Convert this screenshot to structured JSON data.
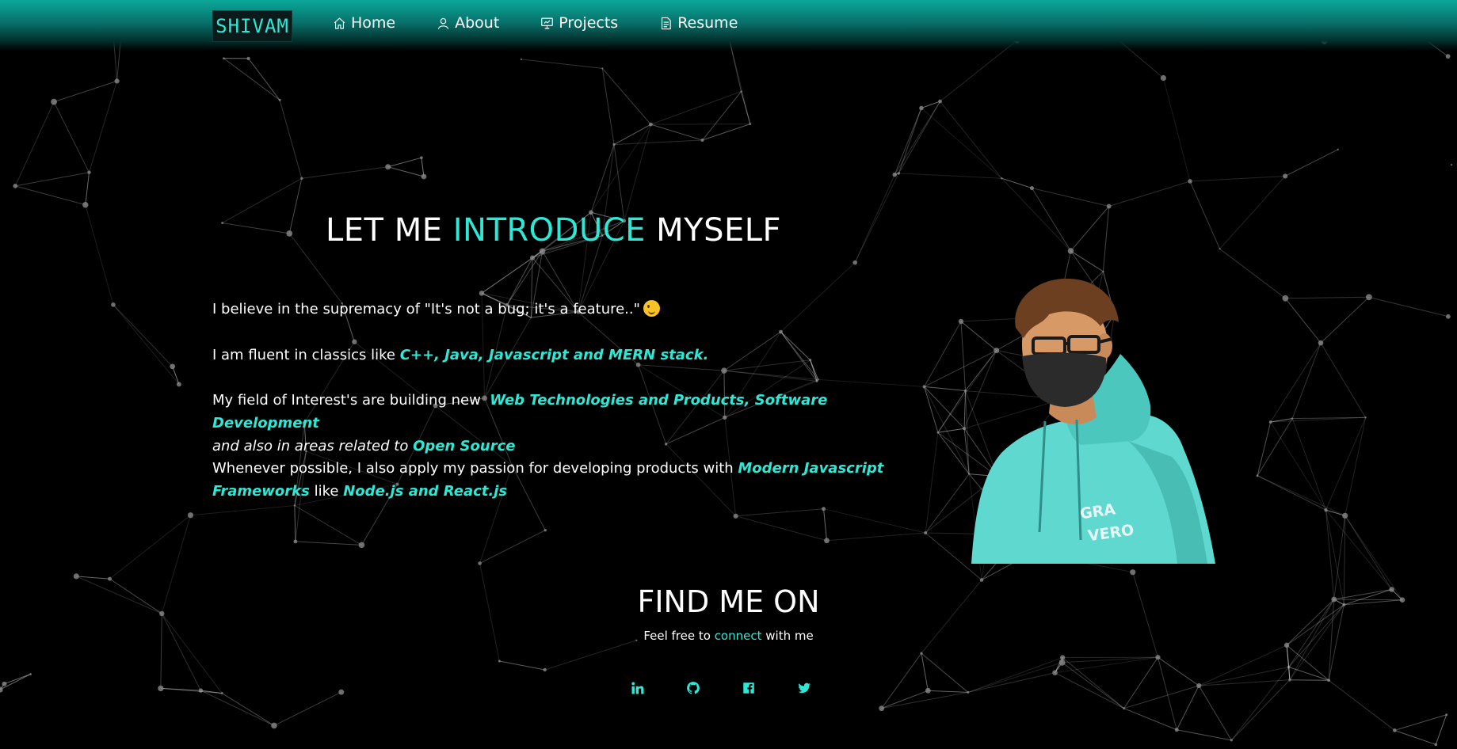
{
  "nav": {
    "logo": "SHIVAM",
    "items": [
      {
        "label": "Home",
        "icon": "home-icon"
      },
      {
        "label": "About",
        "icon": "user-icon"
      },
      {
        "label": "Projects",
        "icon": "presentation-icon"
      },
      {
        "label": "Resume",
        "icon": "document-icon"
      }
    ]
  },
  "intro": {
    "title_part1": "LET ME ",
    "title_accent": "INTRODUCE",
    "title_part2": " MYSELF",
    "p1": "I believe in the supremacy of \"It's not a bug; it's a feature..\"",
    "p2_text": "I am fluent in classics like ",
    "p2_hl": "C++, Java, Javascript and MERN stack.",
    "p3_text": "My field of Interest's are building new ",
    "p3_hl1": "Web Technologies and Products, Software Development",
    "p3_it": "and also in areas related to ",
    "p3_hl2": "Open Source",
    "p4_text": "Whenever possible, I also apply my passion for developing products with ",
    "p4_hl1": "Modern Javascript Frameworks",
    "p4_mid": " like ",
    "p4_hl2": "Node.js and React.js"
  },
  "avatar": {
    "hoodie_text": "GRA VERO"
  },
  "find": {
    "title": "FIND ME ON",
    "sub_text1": "Feel free to ",
    "sub_accent": "connect",
    "sub_text2": " with me",
    "socials": [
      "linkedin-icon",
      "github-icon",
      "facebook-icon",
      "twitter-icon"
    ]
  },
  "colors": {
    "accent": "#2ee8d6",
    "background": "#000000",
    "navbar": "#0aa89a",
    "hoodie": "#5fd8cf"
  }
}
